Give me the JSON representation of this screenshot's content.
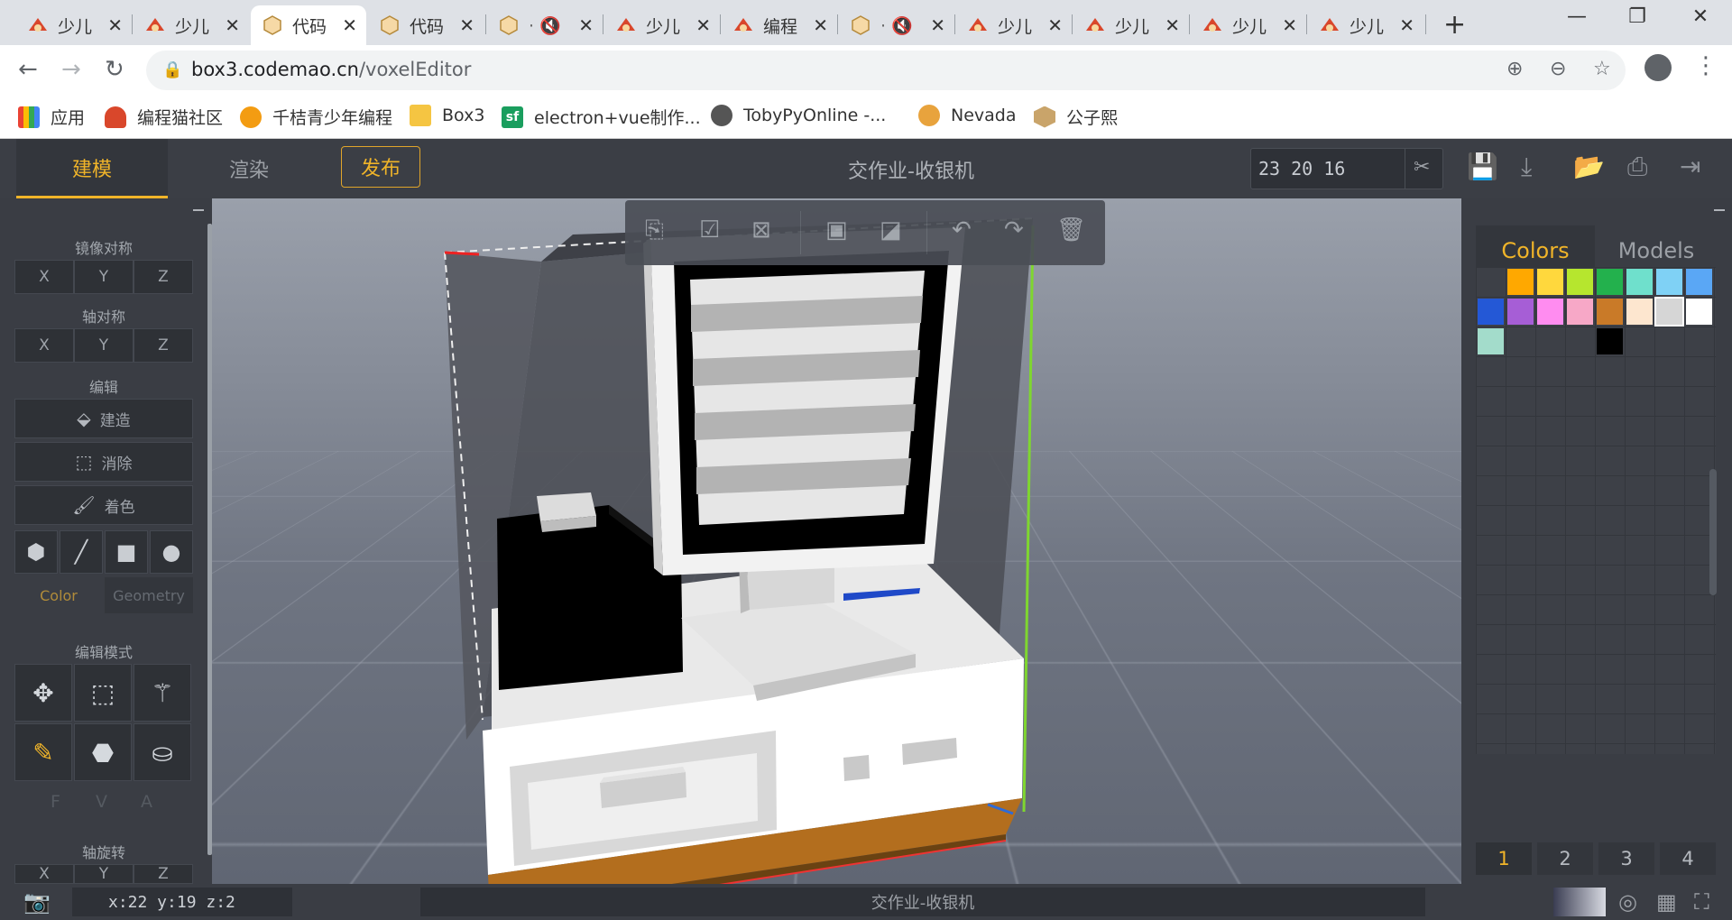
{
  "tabs": [
    {
      "title": "少儿",
      "icon": "codemao-icon"
    },
    {
      "title": "少儿",
      "icon": "codemao-icon"
    },
    {
      "title": "代码",
      "icon": "box3-icon",
      "active": true
    },
    {
      "title": "代码",
      "icon": "box3-icon"
    },
    {
      "title": "",
      "icon": "box3-muted-icon"
    },
    {
      "title": "少儿",
      "icon": "codemao-icon"
    },
    {
      "title": "编程",
      "icon": "codemao-icon"
    },
    {
      "title": "",
      "icon": "box3-muted-icon"
    },
    {
      "title": "少儿",
      "icon": "codemao-icon"
    },
    {
      "title": "少儿",
      "icon": "codemao-icon"
    },
    {
      "title": "少儿",
      "icon": "codemao-icon"
    },
    {
      "title": "少儿",
      "icon": "codemao-icon"
    }
  ],
  "address": {
    "host": "box3.codemao.cn",
    "path": "/voxelEditor"
  },
  "bookmarks": [
    {
      "label": "应用",
      "color": "#4285f4"
    },
    {
      "label": "编程猫社区",
      "color": "#d9472b"
    },
    {
      "label": "千桔青少年编程",
      "color": "#f39c12"
    },
    {
      "label": "Box3",
      "color": "#f5c542"
    },
    {
      "label": "electron+vue制作...",
      "color": "#1a9e5e"
    },
    {
      "label": "TobyPyOnline -...",
      "color": "#555555"
    },
    {
      "label": "Nevada",
      "color": "#e8a33d"
    },
    {
      "label": "公子熙",
      "color": "#c9a46a"
    }
  ],
  "header": {
    "mode_build": "建模",
    "mode_render": "渲染",
    "publish": "发布",
    "project_title": "交作业-收银机",
    "dimensions": "23 20 16"
  },
  "left": {
    "mirror_label": "镜像对称",
    "axis_label": "轴对称",
    "edit_label": "编辑",
    "x": "X",
    "y": "Y",
    "z": "Z",
    "build": "建造",
    "erase": "消除",
    "paint": "着色",
    "color_tab": "Color",
    "geometry_tab": "Geometry",
    "edit_mode_label": "编辑模式",
    "f": "F",
    "v": "V",
    "a": "A",
    "rotate_label": "轴旋转"
  },
  "right": {
    "colors_tab": "Colors",
    "models_tab": "Models",
    "swatches": [
      "#3d4047",
      "#ffa800",
      "#ffd83d",
      "#b6e62e",
      "#23b14d",
      "#6fe0cc",
      "#7fd1f5",
      "#5aa7f5",
      "#2458d6",
      "#a65ed6",
      "#ff8cf0",
      "#f7a8c7",
      "#c97a28",
      "#fde6cf",
      "#d6d6d6",
      "#ffffff",
      "#a3dccb",
      "#000000"
    ],
    "pages": [
      "1",
      "2",
      "3",
      "4"
    ]
  },
  "status": {
    "coords": "x:22  y:19  z:2",
    "title": "交作业-收银机"
  }
}
